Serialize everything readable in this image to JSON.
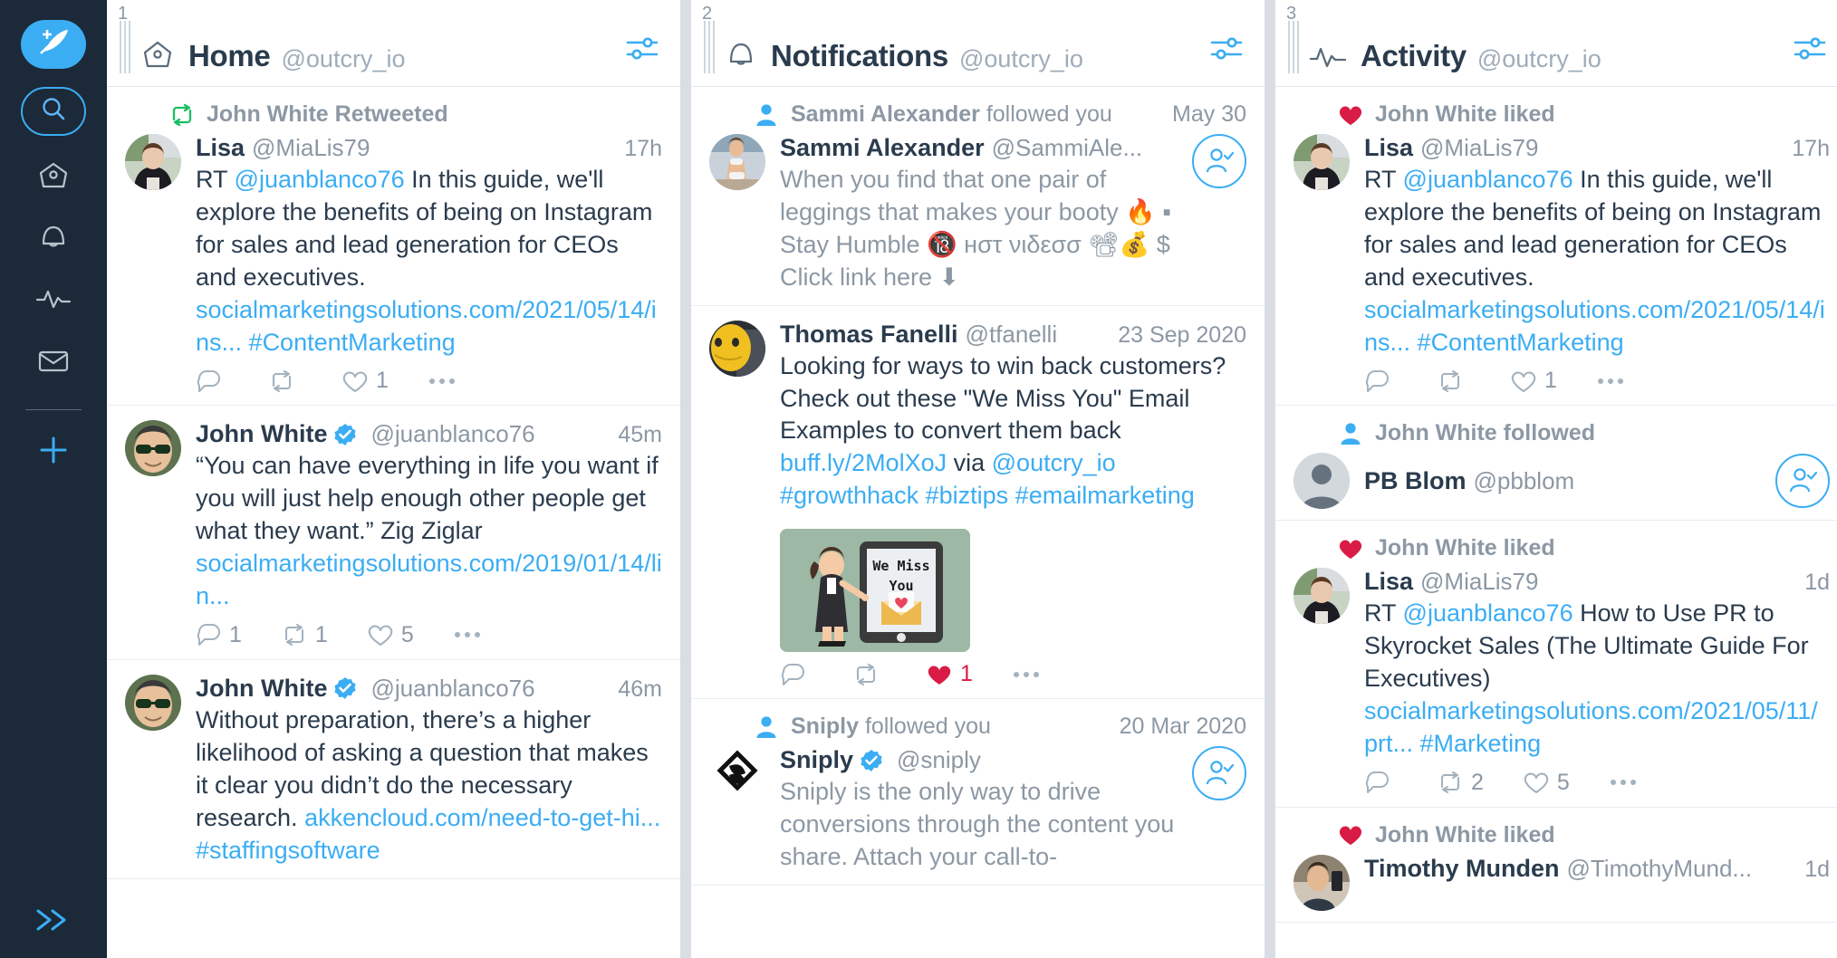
{
  "sidebar": {
    "items": [
      {
        "name": "compose-button",
        "icon": "feather-plus-icon",
        "label": "Compose"
      },
      {
        "name": "search-button",
        "icon": "search-icon",
        "label": "Search"
      },
      {
        "name": "nav-home",
        "icon": "home-icon",
        "label": "Home"
      },
      {
        "name": "nav-notifications",
        "icon": "bell-icon",
        "label": "Notifications"
      },
      {
        "name": "nav-activity",
        "icon": "activity-pulse-icon",
        "label": "Activity"
      },
      {
        "name": "nav-messages",
        "icon": "envelope-icon",
        "label": "Messages"
      },
      {
        "name": "nav-add-column",
        "icon": "plus-icon",
        "label": "Add column"
      }
    ],
    "expand_label": "Expand",
    "expand_icon": "double-chevron-right-icon"
  },
  "colors": {
    "accent": "#3badf3",
    "sidebar_bg": "#1c2938",
    "retweet_green": "#17bf63",
    "like_red": "#d81c45",
    "text_dark": "#2a3b4d",
    "text_muted": "#8c98a4",
    "column_gap": "#d8dee4"
  },
  "columns": [
    {
      "number": "1",
      "icon": "home-icon",
      "title": "Home",
      "handle": "@outcry_io",
      "settings_icon": "sliders-icon",
      "items": [
        {
          "type": "tweet",
          "context_icon": "retweet-icon",
          "context_icon_color": "#17bf63",
          "context_text": "John White Retweeted",
          "avatar": "lisa",
          "display_name": "Lisa",
          "verified": false,
          "handle": "@MiaLis79",
          "time": "17h",
          "text_parts": [
            {
              "t": "RT ",
              "link": false
            },
            {
              "t": "@juanblanco76",
              "link": true
            },
            {
              "t": " In this guide, we'll explore the benefits of being on Instagram for sales and lead generation for CEOs and executives. ",
              "link": false
            },
            {
              "t": "socialmarketingsolutions.com/2021/05/14/ins...",
              "link": true
            },
            {
              "t": " ",
              "link": false
            },
            {
              "t": "#ContentMarketing",
              "link": true
            }
          ],
          "actions": {
            "reply": "",
            "retweet": "",
            "like": "1",
            "liked": false,
            "more_icon": "more-dots-icon"
          }
        },
        {
          "type": "tweet",
          "avatar": "john",
          "display_name": "John White",
          "verified": true,
          "handle": "@juanblanco76",
          "time": "45m",
          "text_parts": [
            {
              "t": "“You can have everything in life you want if you will just help enough other people get what they want.” Zig Ziglar ",
              "link": false
            },
            {
              "t": "socialmarketingsolutions.com/2019/01/14/lin...",
              "link": true
            }
          ],
          "actions": {
            "reply": "1",
            "retweet": "1",
            "like": "5",
            "liked": false,
            "more_icon": "more-dots-icon"
          }
        },
        {
          "type": "tweet",
          "avatar": "john",
          "display_name": "John White",
          "verified": true,
          "handle": "@juanblanco76",
          "time": "46m",
          "text_parts": [
            {
              "t": "Without preparation, there’s a higher likelihood of asking a question that makes it clear you didn’t do the necessary research. ",
              "link": false
            },
            {
              "t": "akkencloud.com/need-to-get-hi...",
              "link": true
            },
            {
              "t": " ",
              "link": false
            },
            {
              "t": "#staffingsoftware",
              "link": true
            }
          ],
          "actions": null
        }
      ]
    },
    {
      "number": "2",
      "icon": "bell-icon",
      "title": "Notifications",
      "handle": "@outcry_io",
      "settings_icon": "sliders-icon",
      "items": [
        {
          "type": "follow",
          "context_icon": "person-icon",
          "context_icon_color": "#3badf3",
          "context_text": "Sammi Alexander followed you",
          "context_bold": "Sammi Alexander",
          "context_rest": " followed you",
          "context_date": "May 30",
          "avatar": "sammi",
          "display_name": "Sammi Alexander",
          "verified": false,
          "handle": "@SammiAle...",
          "bio": "When you find that one pair of leggings that makes your booty 🔥 ▪ Stay Humble 🔞 нστ νιδεσσ 📽💰 $ Click link here ⬇",
          "follow_icon": "follow-user-icon"
        },
        {
          "type": "tweet",
          "avatar": "thomas",
          "display_name": "Thomas Fanelli",
          "verified": false,
          "handle": "@tfanelli",
          "time": "23 Sep 2020",
          "text_parts": [
            {
              "t": "Looking for ways to win back customers? Check out these \"We Miss You\" Email Examples to convert them back ",
              "link": false
            },
            {
              "t": "buff.ly/2MolXoJ",
              "link": true
            },
            {
              "t": " via ",
              "link": false
            },
            {
              "t": "@outcry_io",
              "link": true
            },
            {
              "t": " ",
              "link": false
            },
            {
              "t": "#growthhack",
              "link": true
            },
            {
              "t": " ",
              "link": false
            },
            {
              "t": "#biztips",
              "link": true
            },
            {
              "t": " ",
              "link": false
            },
            {
              "t": "#emailmarketing",
              "link": true
            }
          ],
          "media": {
            "name": "we-miss-you-image",
            "line1": "We Miss",
            "line2": "You"
          },
          "actions": {
            "reply": "",
            "retweet": "",
            "like": "1",
            "liked": true,
            "more_icon": "more-dots-icon"
          }
        },
        {
          "type": "follow",
          "context_icon": "person-icon",
          "context_icon_color": "#3badf3",
          "context_text": "Sniply followed you",
          "context_bold": "Sniply",
          "context_rest": " followed you",
          "context_date": "20 Mar 2020",
          "avatar": "sniply",
          "display_name": "Sniply",
          "verified": true,
          "handle": "@sniply",
          "bio": "Sniply is the only way to drive conversions through the content you share. Attach your call-to-",
          "follow_icon": "follow-user-icon"
        }
      ]
    },
    {
      "number": "3",
      "icon": "activity-pulse-icon",
      "title": "Activity",
      "handle": "@outcry_io",
      "settings_icon": "sliders-icon",
      "items": [
        {
          "type": "tweet",
          "context_icon": "heart-filled-icon",
          "context_icon_color": "#d81c45",
          "context_text": "John White liked",
          "avatar": "lisa",
          "display_name": "Lisa",
          "verified": false,
          "handle": "@MiaLis79",
          "time": "17h",
          "text_parts": [
            {
              "t": "RT ",
              "link": false
            },
            {
              "t": "@juanblanco76",
              "link": true
            },
            {
              "t": " In this guide, we'll explore the benefits of being on Instagram for sales and lead generation for CEOs and executives. ",
              "link": false
            },
            {
              "t": "socialmarketingsolutions.com/2021/05/14/ins...",
              "link": true
            },
            {
              "t": " ",
              "link": false
            },
            {
              "t": "#ContentMarketing",
              "link": true
            }
          ],
          "actions": {
            "reply": "",
            "retweet": "",
            "like": "1",
            "liked": false,
            "more_icon": "more-dots-icon"
          }
        },
        {
          "type": "follow",
          "context_icon": "person-icon",
          "context_icon_color": "#3badf3",
          "context_text": "John White followed",
          "context_bold": "John White",
          "context_rest": " followed",
          "context_date": "",
          "avatar": "placeholder",
          "display_name": "PB Blom",
          "verified": false,
          "handle": "@pbblom",
          "bio": "",
          "follow_icon": "follow-user-icon"
        },
        {
          "type": "tweet",
          "context_icon": "heart-filled-icon",
          "context_icon_color": "#d81c45",
          "context_text": "John White liked",
          "avatar": "lisa",
          "display_name": "Lisa",
          "verified": false,
          "handle": "@MiaLis79",
          "time": "1d",
          "text_parts": [
            {
              "t": "RT ",
              "link": false
            },
            {
              "t": "@juanblanco76",
              "link": true
            },
            {
              "t": " How to Use PR to Skyrocket Sales (The Ultimate Guide For Executives) ",
              "link": false
            },
            {
              "t": "socialmarketingsolutions.com/2021/05/11/prt...",
              "link": true
            },
            {
              "t": " ",
              "link": false
            },
            {
              "t": "#Marketing",
              "link": true
            }
          ],
          "actions": {
            "reply": "",
            "retweet": "2",
            "like": "5",
            "liked": false,
            "more_icon": "more-dots-icon"
          }
        },
        {
          "type": "tweet",
          "context_icon": "heart-filled-icon",
          "context_icon_color": "#d81c45",
          "context_text": "John White liked",
          "avatar": "timothy",
          "display_name": "Timothy Munden",
          "verified": false,
          "handle": "@TimothyMund...",
          "time": "1d",
          "text_parts": [],
          "actions": null
        }
      ]
    }
  ]
}
